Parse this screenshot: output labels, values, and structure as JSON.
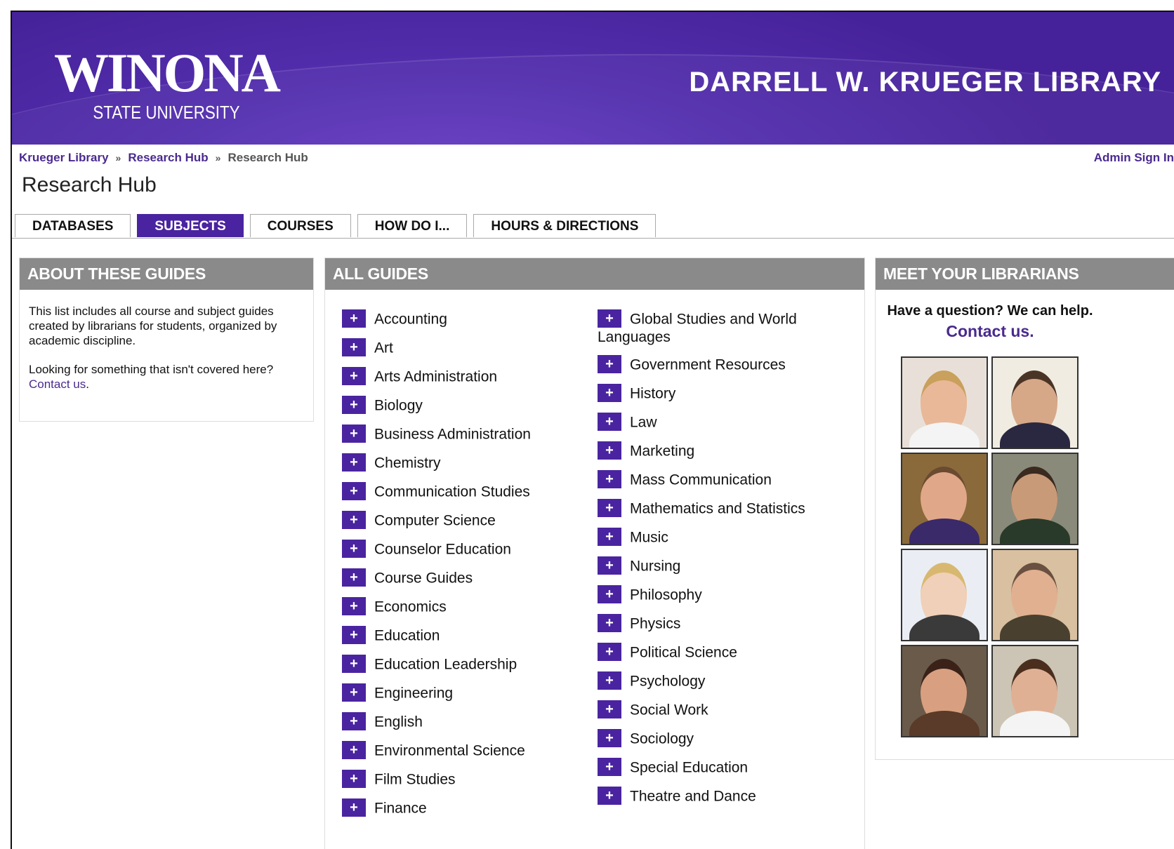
{
  "header": {
    "logo_name": "WINONA",
    "logo_sub": "STATE UNIVERSITY",
    "library_title": "DARRELL W. KRUEGER LIBRARY"
  },
  "breadcrumb": {
    "items": [
      "Krueger Library",
      "Research Hub",
      "Research Hub"
    ],
    "separator": "»"
  },
  "admin_link": "Admin Sign In",
  "page_title": "Research Hub",
  "tabs": [
    {
      "label": "DATABASES",
      "active": false
    },
    {
      "label": "SUBJECTS",
      "active": true
    },
    {
      "label": "COURSES",
      "active": false
    },
    {
      "label": "HOW DO I...",
      "active": false
    },
    {
      "label": "HOURS & DIRECTIONS",
      "active": false
    }
  ],
  "about": {
    "title": "ABOUT THESE GUIDES",
    "para1": "This list includes all course and subject guides created by librarians for students, organized by academic discipline.",
    "para2_prefix": "Looking for something that isn't covered here?",
    "para2_link": "Contact us",
    "para2_suffix": "."
  },
  "guides": {
    "title": "ALL GUIDES",
    "left": [
      "Accounting",
      "Art",
      "Arts Administration",
      "Biology",
      "Business Administration",
      "Chemistry",
      "Communication Studies",
      "Computer Science",
      "Counselor Education",
      "Course Guides",
      "Economics",
      "Education",
      "Education Leadership",
      "Engineering",
      "English",
      "Environmental Science",
      "Film Studies",
      "Finance"
    ],
    "right": [
      "Global Studies and World Languages",
      "Government Resources",
      "History",
      "Law",
      "Marketing",
      "Mass Communication",
      "Mathematics and Statistics",
      "Music",
      "Nursing",
      "Philosophy",
      "Physics",
      "Political Science",
      "Psychology",
      "Social Work",
      "Sociology",
      "Special Education",
      "Theatre and Dance"
    ],
    "plus_glyph": "+"
  },
  "librarians": {
    "title": "MEET YOUR LIBRARIANS",
    "question": "Have a question? We can help.",
    "contact": "Contact us."
  },
  "colors": {
    "brand_purple": "#4a24a0",
    "panel_head": "#8a8a8a",
    "link": "#4a2a8f"
  }
}
